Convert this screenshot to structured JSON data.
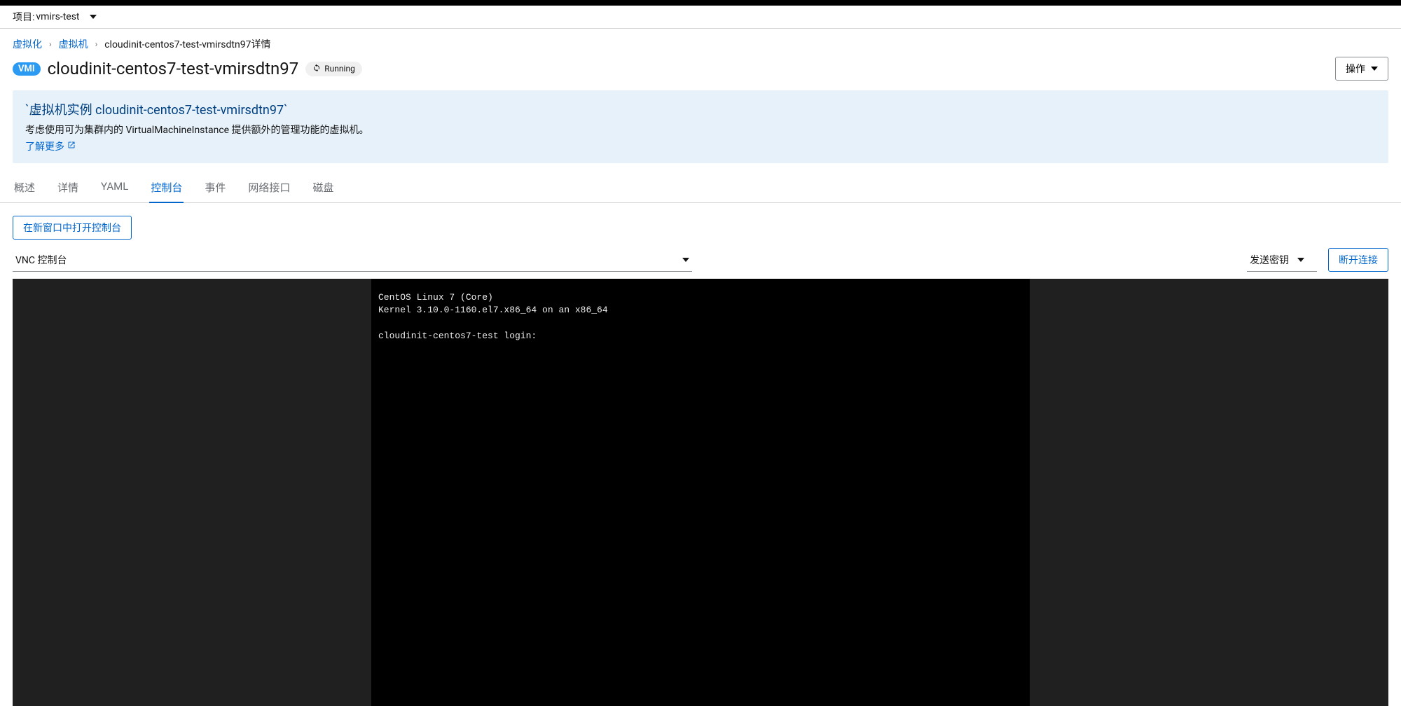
{
  "project": {
    "label": "项目:",
    "name": "vmirs-test"
  },
  "breadcrumb": {
    "items": [
      {
        "label": "虚拟化",
        "link": true
      },
      {
        "label": "虚拟机",
        "link": true
      },
      {
        "label": "cloudinit-centos7-test-vmirsdtn97详情",
        "link": false
      }
    ]
  },
  "header": {
    "badge": "VMI",
    "title": "cloudinit-centos7-test-vmirsdtn97",
    "status": "Running",
    "actions_label": "操作"
  },
  "info_banner": {
    "title": "`虚拟机实例 cloudinit-centos7-test-vmirsdtn97`",
    "text": "考虑使用可为集群内的 VirtualMachineInstance 提供额外的管理功能的虚拟机。",
    "learn_more": "了解更多"
  },
  "tabs": [
    {
      "label": "概述",
      "active": false
    },
    {
      "label": "详情",
      "active": false
    },
    {
      "label": "YAML",
      "active": false
    },
    {
      "label": "控制台",
      "active": true
    },
    {
      "label": "事件",
      "active": false
    },
    {
      "label": "网络接口",
      "active": false
    },
    {
      "label": "磁盘",
      "active": false
    }
  ],
  "console": {
    "open_new_window": "在新窗口中打开控制台",
    "type_selected": "VNC 控制台",
    "send_key": "发送密钥",
    "disconnect": "断开连接"
  },
  "terminal": {
    "line1": "CentOS Linux 7 (Core)",
    "line2": "Kernel 3.10.0-1160.el7.x86_64 on an x86_64",
    "line3": "",
    "line4": "cloudinit-centos7-test login:"
  }
}
